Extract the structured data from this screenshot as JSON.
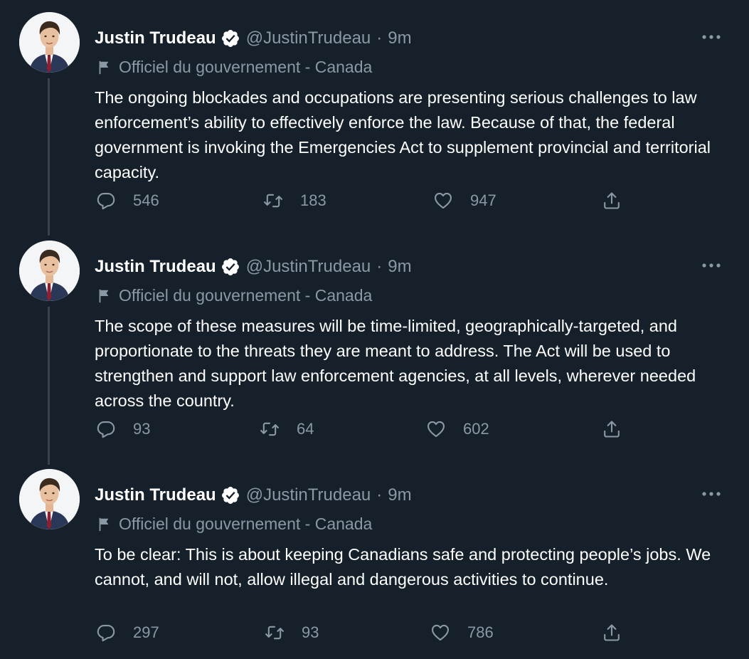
{
  "author": {
    "name": "Justin Trudeau",
    "handle": "@JustinTrudeau",
    "separator": "·",
    "label": "Officiel du gouvernement - Canada"
  },
  "tweets": [
    {
      "time": "9m",
      "text": "The ongoing blockades and occupations are presenting serious challenges to law enforcement’s ability to effectively enforce the law. Because of that, the federal government is invoking the Emergencies Act to supplement provincial and territorial capacity.",
      "replies": "546",
      "retweets": "183",
      "likes": "947"
    },
    {
      "time": "9m",
      "text": "The scope of these measures will be time-limited, geographically-targeted, and proportionate to the threats they are meant to address. The Act will be used to strengthen and support law enforcement agencies, at all levels, wherever needed across the country.",
      "replies": "93",
      "retweets": "64",
      "likes": "602"
    },
    {
      "time": "9m",
      "text": "To be clear: This is about keeping Canadians safe and protecting people’s jobs. We cannot, and will not, allow illegal and dangerous activities to continue.",
      "replies": "297",
      "retweets": "93",
      "likes": "786"
    }
  ],
  "colors": {
    "background": "#15202b",
    "text": "#ffffff",
    "muted": "#8b98a5",
    "thread_line": "#38444d"
  },
  "icons": {
    "reply": "reply-icon",
    "retweet": "retweet-icon",
    "like": "heart-icon",
    "share": "share-icon",
    "verified": "verified-badge-icon",
    "label": "flag-icon",
    "more": "more-icon"
  }
}
